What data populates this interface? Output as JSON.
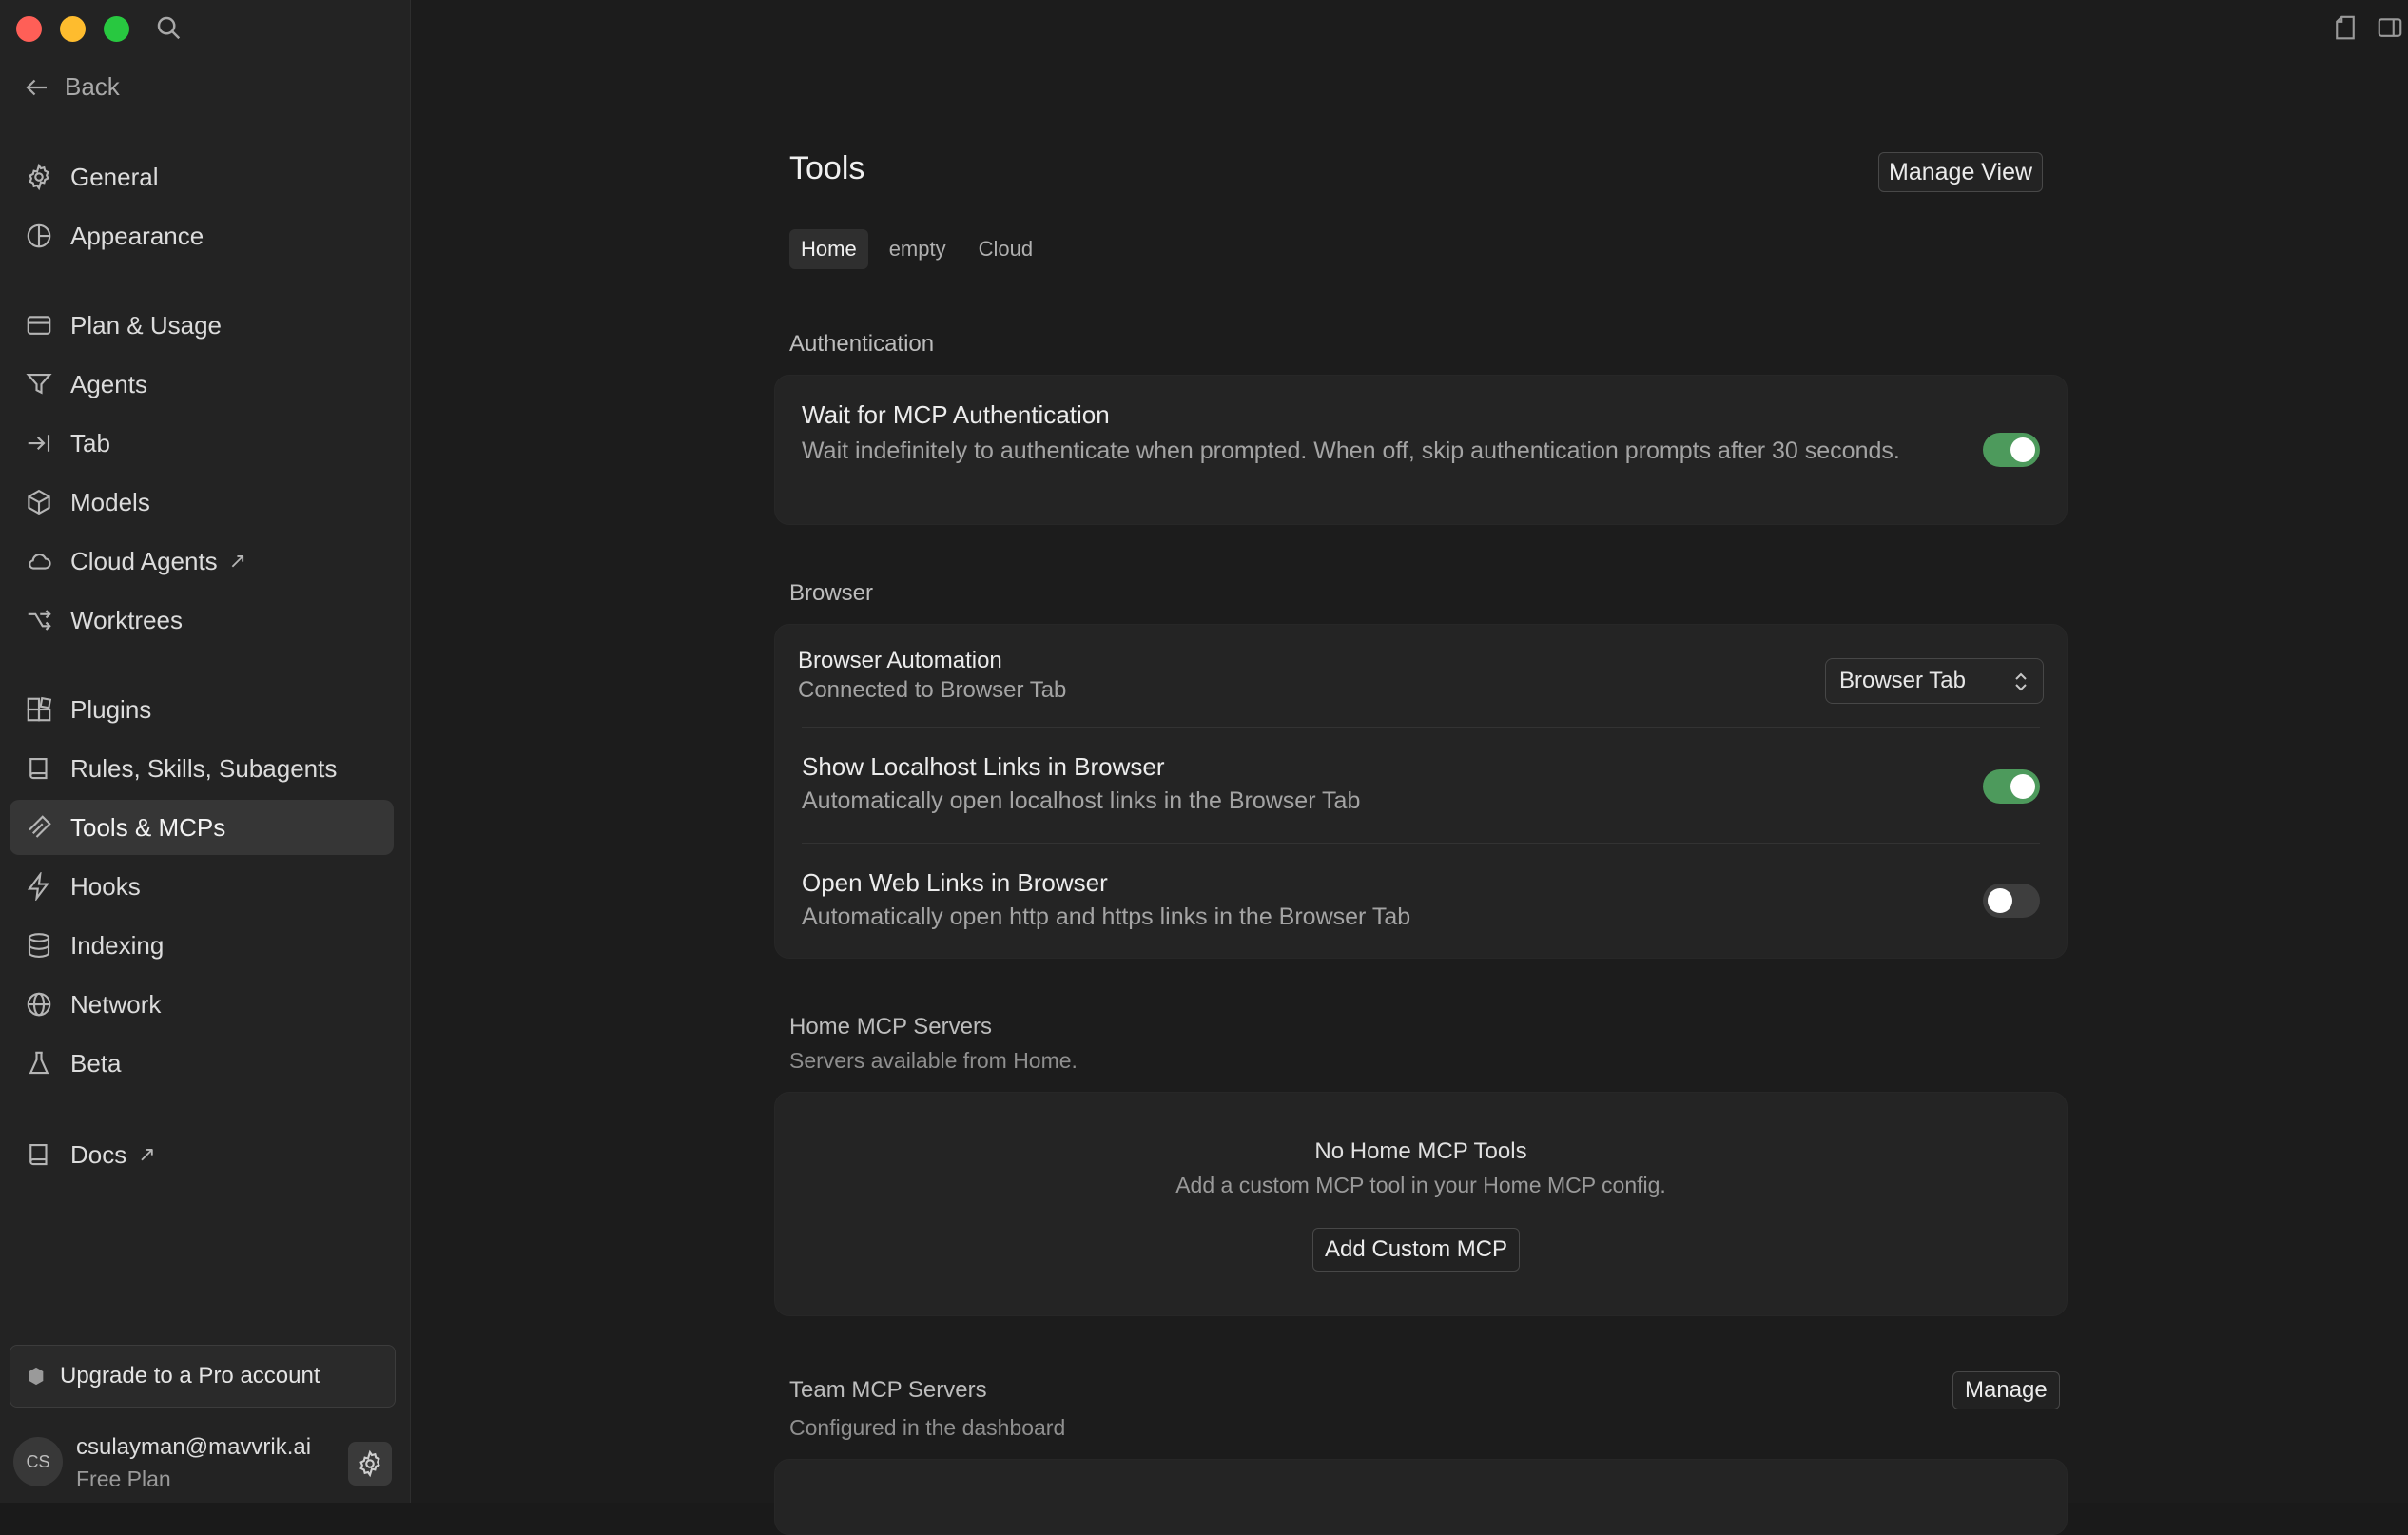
{
  "sidebar": {
    "back_label": "Back",
    "items": [
      {
        "label": "General",
        "icon": "gear-icon"
      },
      {
        "label": "Appearance",
        "icon": "palette-icon"
      },
      {
        "label": "Plan & Usage",
        "icon": "card-icon"
      },
      {
        "label": "Agents",
        "icon": "funnel-icon"
      },
      {
        "label": "Tab",
        "icon": "tab-key-icon"
      },
      {
        "label": "Models",
        "icon": "cube-icon"
      },
      {
        "label": "Cloud Agents",
        "icon": "cloud-icon",
        "external": "↗"
      },
      {
        "label": "Worktrees",
        "icon": "branch-icon"
      },
      {
        "label": "Plugins",
        "icon": "blocks-icon"
      },
      {
        "label": "Rules, Skills, Subagents",
        "icon": "book-icon"
      },
      {
        "label": "Tools & MCPs",
        "icon": "tools-icon",
        "active": true
      },
      {
        "label": "Hooks",
        "icon": "lightning-icon"
      },
      {
        "label": "Indexing",
        "icon": "database-icon"
      },
      {
        "label": "Network",
        "icon": "globe-icon"
      },
      {
        "label": "Beta",
        "icon": "flask-icon"
      },
      {
        "label": "Docs",
        "icon": "book-icon",
        "external": "↗"
      }
    ],
    "upgrade_label": "Upgrade to a Pro account",
    "account": {
      "initials": "CS",
      "email": "csulayman@mavvrik.ai",
      "plan": "Free Plan"
    }
  },
  "main": {
    "title": "Tools",
    "manage_view_label": "Manage View",
    "tabs": [
      "Home",
      "empty",
      "Cloud"
    ],
    "authentication": {
      "section_title": "Authentication",
      "wait_title": "Wait for MCP Authentication",
      "wait_desc": "Wait indefinitely to authenticate when prompted. When off, skip authentication prompts after 30 seconds.",
      "wait_enabled": true
    },
    "browser": {
      "section_title": "Browser",
      "automation_title": "Browser Automation",
      "automation_desc": "Connected to Browser Tab",
      "automation_value": "Browser Tab",
      "localhost_title": "Show Localhost Links in Browser",
      "localhost_desc": "Automatically open localhost links in the Browser Tab",
      "localhost_enabled": true,
      "web_title": "Open Web Links in Browser",
      "web_desc": "Automatically open http and https links in the Browser Tab",
      "web_enabled": false
    },
    "home_mcp": {
      "section_title": "Home MCP Servers",
      "section_sub": "Servers available from Home.",
      "empty_title": "No Home MCP Tools",
      "empty_sub": "Add a custom MCP tool in your Home MCP config.",
      "add_label": "Add Custom MCP"
    },
    "team_mcp": {
      "section_title": "Team MCP Servers",
      "section_sub": "Configured in the dashboard",
      "manage_label": "Manage"
    }
  },
  "colors": {
    "accent_toggle": "#4d9a5c",
    "sidebar_bg": "#232323",
    "main_bg": "#1c1c1c",
    "card_bg": "#242424"
  }
}
